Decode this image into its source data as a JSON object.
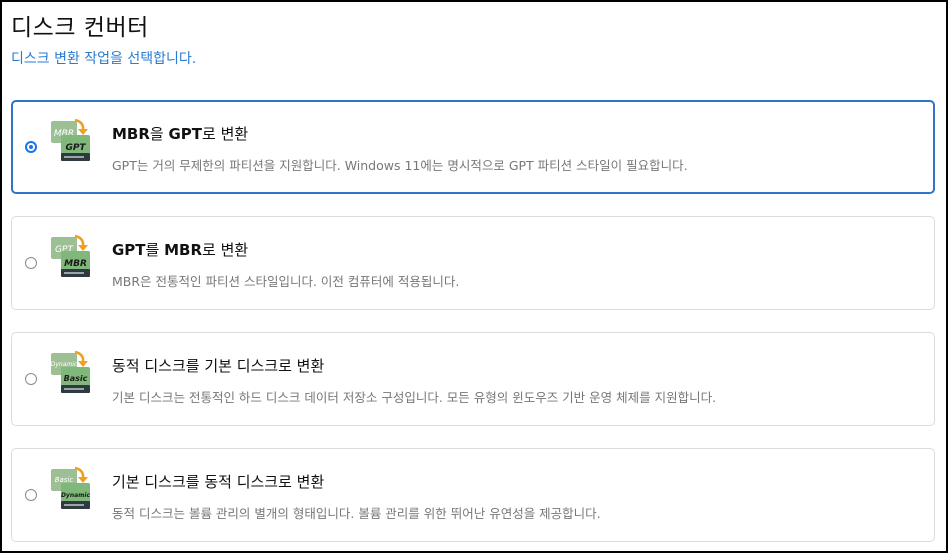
{
  "page": {
    "title": "디스크 컨버터",
    "subtitle": "디스크 변환 작업을 선택합니다."
  },
  "options": [
    {
      "selected": true,
      "title_a": "MBR",
      "title_b": "을 ",
      "title_c": "GPT",
      "title_d": "로 변환",
      "description": "GPT는 거의 무제한의 파티션을 지원합니다. Windows 11에는 명시적으로 GPT 파티션 스타일이 필요합니다.",
      "icon": {
        "name": "mbr-to-gpt-icon",
        "top_label": "MBR",
        "bottom_label": "GPT"
      }
    },
    {
      "selected": false,
      "title_a": "GPT",
      "title_b": "를 ",
      "title_c": "MBR",
      "title_d": "로 변환",
      "description": "MBR은 전통적인 파티션 스타일입니다. 이전 컴퓨터에 적용됩니다.",
      "icon": {
        "name": "gpt-to-mbr-icon",
        "top_label": "GPT",
        "bottom_label": "MBR"
      }
    },
    {
      "selected": false,
      "title": "동적 디스크를 기본 디스크로 변환",
      "description": "기본 디스크는 전통적인 하드 디스크 데이터 저장소 구성입니다. 모든 유형의 윈도우즈 기반 운영 체제를 지원합니다.",
      "icon": {
        "name": "dynamic-to-basic-icon",
        "top_label": "Dynamic",
        "bottom_label": "Basic"
      }
    },
    {
      "selected": false,
      "title": "기본 디스크를 동적 디스크로 변환",
      "description": "동적 디스크는 볼륨 관리의 별개의 형태입니다. 볼륨 관리를 위한 뛰어난 유연성을 제공합니다.",
      "icon": {
        "name": "basic-to-dynamic-icon",
        "top_label": "Basic",
        "bottom_label": "Dynamic"
      }
    }
  ],
  "colors": {
    "accent": "#2f74c9",
    "subtitle": "#2a7bd3",
    "icon_green": "#7fb87a",
    "icon_dark": "#2f3a40",
    "arrow_orange": "#f0a020"
  }
}
